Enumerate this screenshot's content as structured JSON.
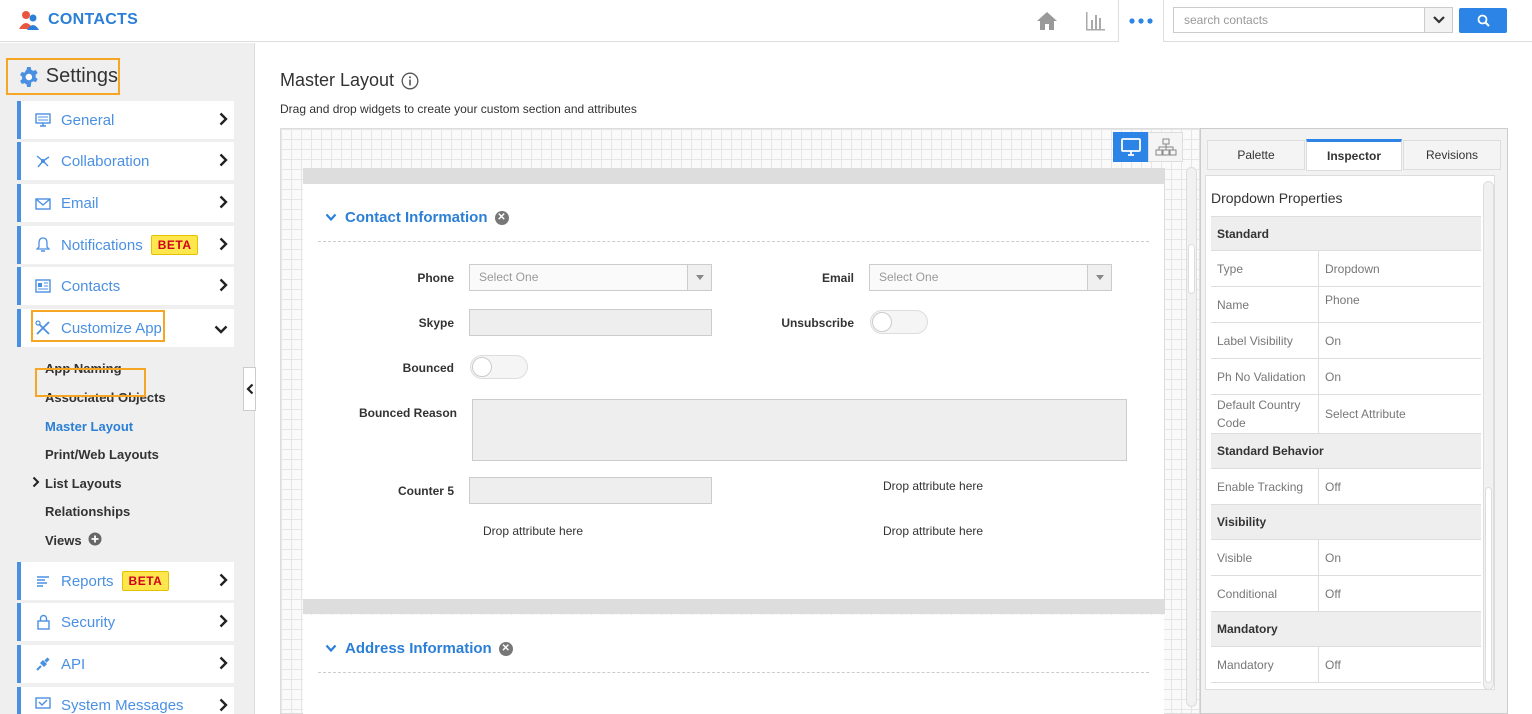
{
  "app": {
    "title": "CONTACTS"
  },
  "search": {
    "placeholder": "search contacts"
  },
  "colors": {
    "accent": "#2b84e6",
    "highlight": "#f5a623",
    "beta_bg": "#fde74c",
    "beta_text": "#d0021b"
  },
  "sidebar": {
    "heading": "Settings",
    "items": [
      {
        "label": "General",
        "icon": "monitor-icon"
      },
      {
        "label": "Collaboration",
        "icon": "collaboration-icon"
      },
      {
        "label": "Email",
        "icon": "email-icon"
      },
      {
        "label": "Notifications",
        "icon": "bell-icon",
        "badge": "BETA"
      },
      {
        "label": "Contacts",
        "icon": "contacts-icon"
      },
      {
        "label": "Customize App",
        "icon": "tools-icon"
      },
      {
        "label": "Reports",
        "icon": "reports-icon",
        "badge": "BETA"
      },
      {
        "label": "Security",
        "icon": "lock-icon"
      },
      {
        "label": "API",
        "icon": "plug-icon"
      },
      {
        "label": "System Messages",
        "icon": "message-icon"
      }
    ],
    "sub_items": [
      "App Naming",
      "Associated Objects",
      "Master Layout",
      "Print/Web Layouts",
      "List Layouts",
      "Relationships",
      "Views"
    ]
  },
  "main": {
    "title": "Master Layout",
    "description": "Drag and drop widgets to create your custom section and attributes",
    "sections": [
      {
        "title": "Contact Information"
      },
      {
        "title": "Address Information"
      }
    ],
    "fields": {
      "phone": {
        "label": "Phone",
        "value": "Select One"
      },
      "email": {
        "label": "Email",
        "value": "Select One"
      },
      "skype": {
        "label": "Skype"
      },
      "unsubscribe": {
        "label": "Unsubscribe"
      },
      "bounced": {
        "label": "Bounced"
      },
      "bounced_reason": {
        "label": "Bounced Reason"
      },
      "counter5": {
        "label": "Counter 5"
      }
    },
    "drop_hint": "Drop attribute here"
  },
  "panel": {
    "tabs": [
      "Palette",
      "Inspector",
      "Revisions"
    ],
    "heading": "Dropdown Properties",
    "groups": {
      "standard": "Standard",
      "standard_behavior": "Standard Behavior",
      "visibility": "Visibility",
      "mandatory": "Mandatory"
    },
    "rows": {
      "type": {
        "key": "Type",
        "value": "Dropdown"
      },
      "name": {
        "key": "Name",
        "value": "Phone"
      },
      "label_visibility": {
        "key": "Label Visibility",
        "value": "On"
      },
      "ph_no_validation": {
        "key": "Ph No Validation",
        "value": "On"
      },
      "default_country_code": {
        "key": "Default Country Code",
        "value": "Select Attribute"
      },
      "enable_tracking": {
        "key": "Enable Tracking",
        "value": "Off"
      },
      "visible": {
        "key": "Visible",
        "value": "On"
      },
      "conditional": {
        "key": "Conditional",
        "value": "Off"
      },
      "mandatory": {
        "key": "Mandatory",
        "value": "Off"
      }
    }
  }
}
